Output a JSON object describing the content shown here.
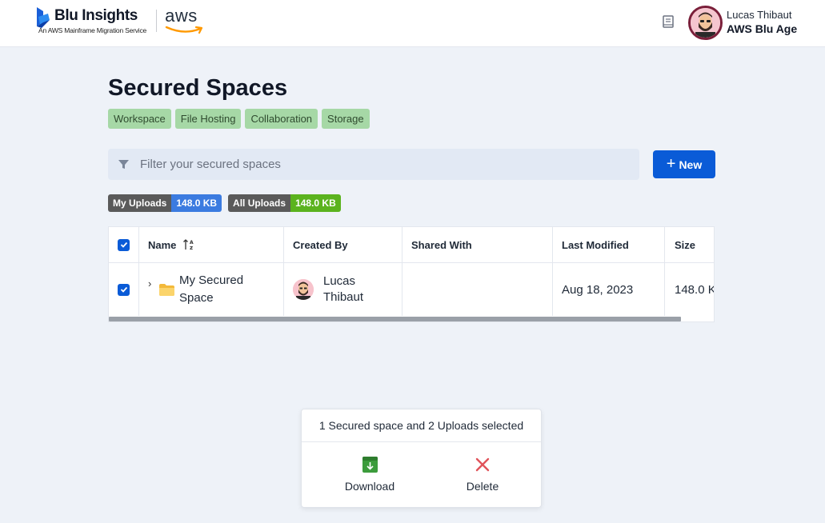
{
  "header": {
    "brand_title": "Blu Insights",
    "brand_subtitle": "An AWS Mainframe Migration Service",
    "aws_logo_text": "aws",
    "docs_icon": "book-icon",
    "user": {
      "name": "Lucas Thibaut",
      "organization": "AWS Blu Age"
    }
  },
  "page": {
    "title": "Secured Spaces",
    "tags": [
      "Workspace",
      "File Hosting",
      "Collaboration",
      "Storage"
    ]
  },
  "filter": {
    "placeholder": "Filter your secured spaces",
    "icon": "filter-icon"
  },
  "new_button": {
    "label": "New",
    "icon": "plus-icon",
    "color": "#0a5bd7"
  },
  "usage": {
    "my_uploads": {
      "label": "My Uploads",
      "value": "148.0 KB",
      "color": "#3b7be0"
    },
    "all_uploads": {
      "label": "All Uploads",
      "value": "148.0 KB",
      "color": "#5bb31e"
    }
  },
  "table": {
    "columns": [
      "Name",
      "Created By",
      "Shared With",
      "Last Modified",
      "Size"
    ],
    "select_all_checked": true,
    "rows": [
      {
        "checked": true,
        "name": "My Secured Space",
        "created_by": "Lucas Thibaut",
        "shared_with": "",
        "last_modified": "Aug 18, 2023",
        "size": "148.0 K"
      }
    ]
  },
  "selection": {
    "summary": "1 Secured space and 2 Uploads selected",
    "actions": [
      {
        "label": "Download",
        "icon": "download-icon",
        "color": "#3c9c3c"
      },
      {
        "label": "Delete",
        "icon": "delete-x-icon",
        "color": "#e0535a"
      }
    ]
  }
}
